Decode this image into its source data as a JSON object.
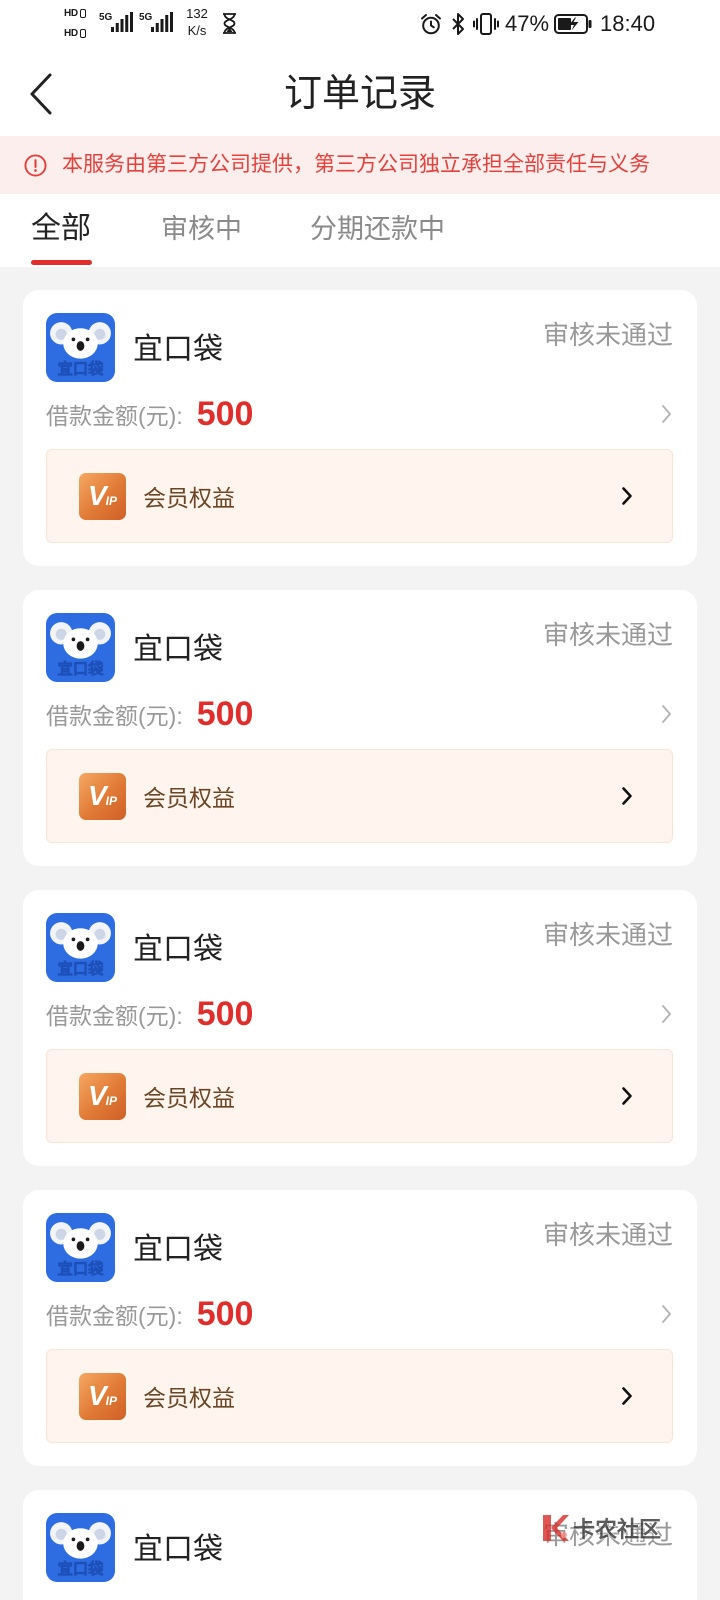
{
  "status_bar": {
    "hd_label": "HD",
    "network_1": "5G",
    "network_2": "5G",
    "speed_value": "132",
    "speed_unit": "K/s",
    "battery_percent": "47%",
    "time": "18:40",
    "icons": [
      "hd-icon",
      "signal-icon",
      "hourglass-icon",
      "alarm-icon",
      "bluetooth-icon",
      "vibrate-icon",
      "battery-charging-icon"
    ]
  },
  "header": {
    "title": "订单记录",
    "back_icon": "chevron-left-icon"
  },
  "notice": {
    "icon": "alert-circle-icon",
    "text": "本服务由第三方公司提供，第三方公司独立承担全部责任与义务"
  },
  "tabs": [
    {
      "label": "全部",
      "active": true
    },
    {
      "label": "审核中",
      "active": false
    },
    {
      "label": "分期还款中",
      "active": false
    }
  ],
  "orders": [
    {
      "product_name": "宜口袋",
      "logo_text": "宜口袋",
      "status": "审核未通过",
      "amount_label": "借款金额(元):",
      "amount": "500",
      "benefit_label": "会员权益",
      "benefit_badge": {
        "big": "V",
        "small": "IP"
      },
      "detail_icon": "chevron-right-icon"
    },
    {
      "product_name": "宜口袋",
      "logo_text": "宜口袋",
      "status": "审核未通过",
      "amount_label": "借款金额(元):",
      "amount": "500",
      "benefit_label": "会员权益",
      "benefit_badge": {
        "big": "V",
        "small": "IP"
      },
      "detail_icon": "chevron-right-icon"
    },
    {
      "product_name": "宜口袋",
      "logo_text": "宜口袋",
      "status": "审核未通过",
      "amount_label": "借款金额(元):",
      "amount": "500",
      "benefit_label": "会员权益",
      "benefit_badge": {
        "big": "V",
        "small": "IP"
      },
      "detail_icon": "chevron-right-icon"
    },
    {
      "product_name": "宜口袋",
      "logo_text": "宜口袋",
      "status": "审核未通过",
      "amount_label": "借款金额(元):",
      "amount": "500",
      "benefit_label": "会员权益",
      "benefit_badge": {
        "big": "V",
        "small": "IP"
      },
      "detail_icon": "chevron-right-icon"
    },
    {
      "product_name": "宜口袋",
      "logo_text": "宜口袋",
      "status": "审核未通过"
    }
  ],
  "watermark": {
    "text": "卡农社区"
  },
  "colors": {
    "page_bg": "#f3f3f3",
    "accent_red": "#e22d2d",
    "notice_bg": "#fdeeee",
    "notice_text": "#e5413c",
    "text_primary": "#222222",
    "text_secondary": "#999999",
    "vip_bg": "#fff5ee",
    "vip_border": "#fbe4d4",
    "vip_text": "#6b4526",
    "logo_blue": "#2e6ce2"
  }
}
